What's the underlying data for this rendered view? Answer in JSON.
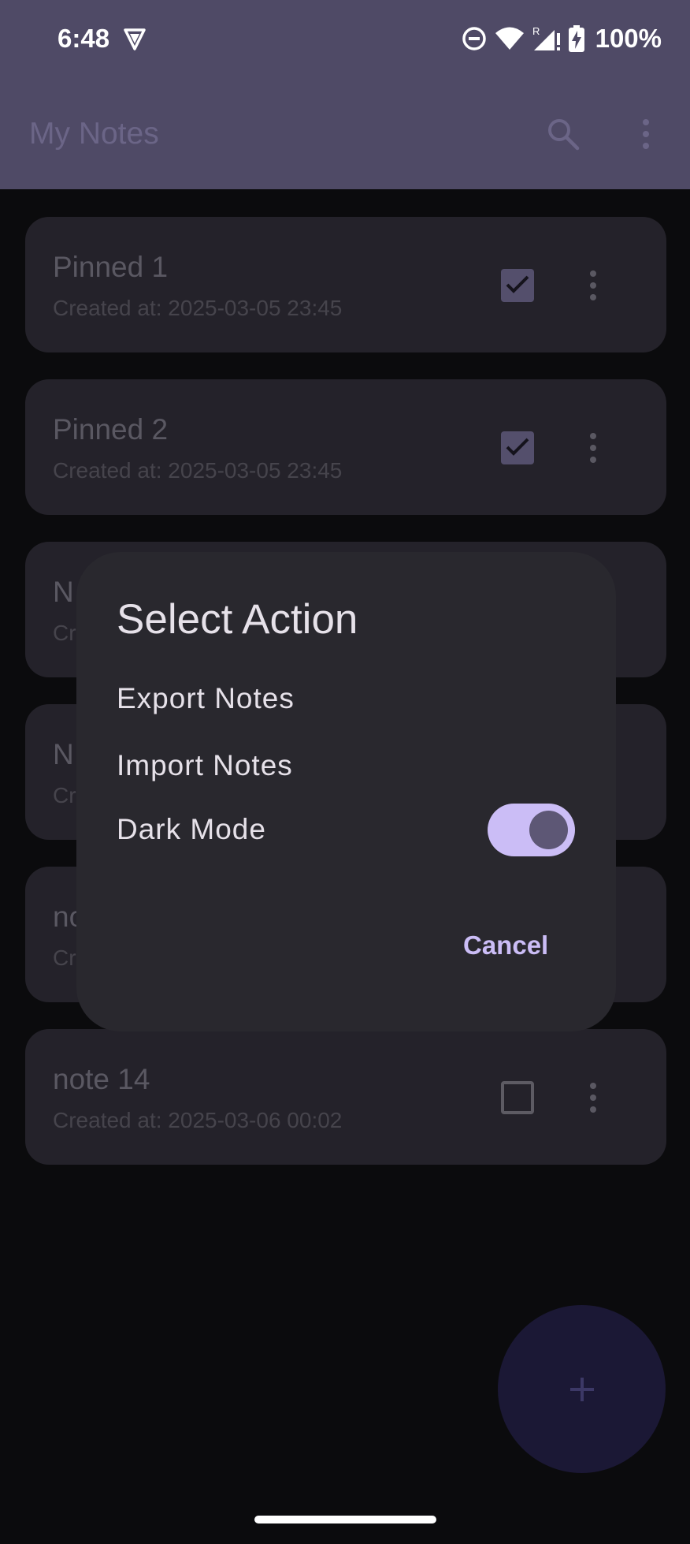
{
  "status": {
    "time": "6:48",
    "roaming": "R",
    "battery": "100%"
  },
  "appbar": {
    "title": "My Notes",
    "search_icon": "search-icon",
    "more_icon": "more-vert-icon"
  },
  "notes": [
    {
      "title": "Pinned 1",
      "date": "Created at: 2025-03-05 23:45",
      "checked": true
    },
    {
      "title": "Pinned 2",
      "date": "Created at: 2025-03-05 23:45",
      "checked": true
    },
    {
      "title": "N",
      "date": "Cr",
      "checked": false
    },
    {
      "title": "N",
      "date": "Cr",
      "checked": false
    },
    {
      "title": "no",
      "date": "Cr",
      "checked": false
    },
    {
      "title": "note 14",
      "date": "Created at: 2025-03-06 00:02",
      "checked": false
    }
  ],
  "dialog": {
    "title": "Select Action",
    "export_label": "Export Notes",
    "import_label": "Import Notes",
    "dark_mode_label": "Dark Mode",
    "dark_mode_on": true,
    "cancel_label": "Cancel"
  },
  "fab": {
    "icon": "plus-icon"
  },
  "colors": {
    "accent": "#cbbdf6",
    "appbar": "#4f4a66",
    "dialog": "#29282e",
    "card": "#24222a"
  }
}
